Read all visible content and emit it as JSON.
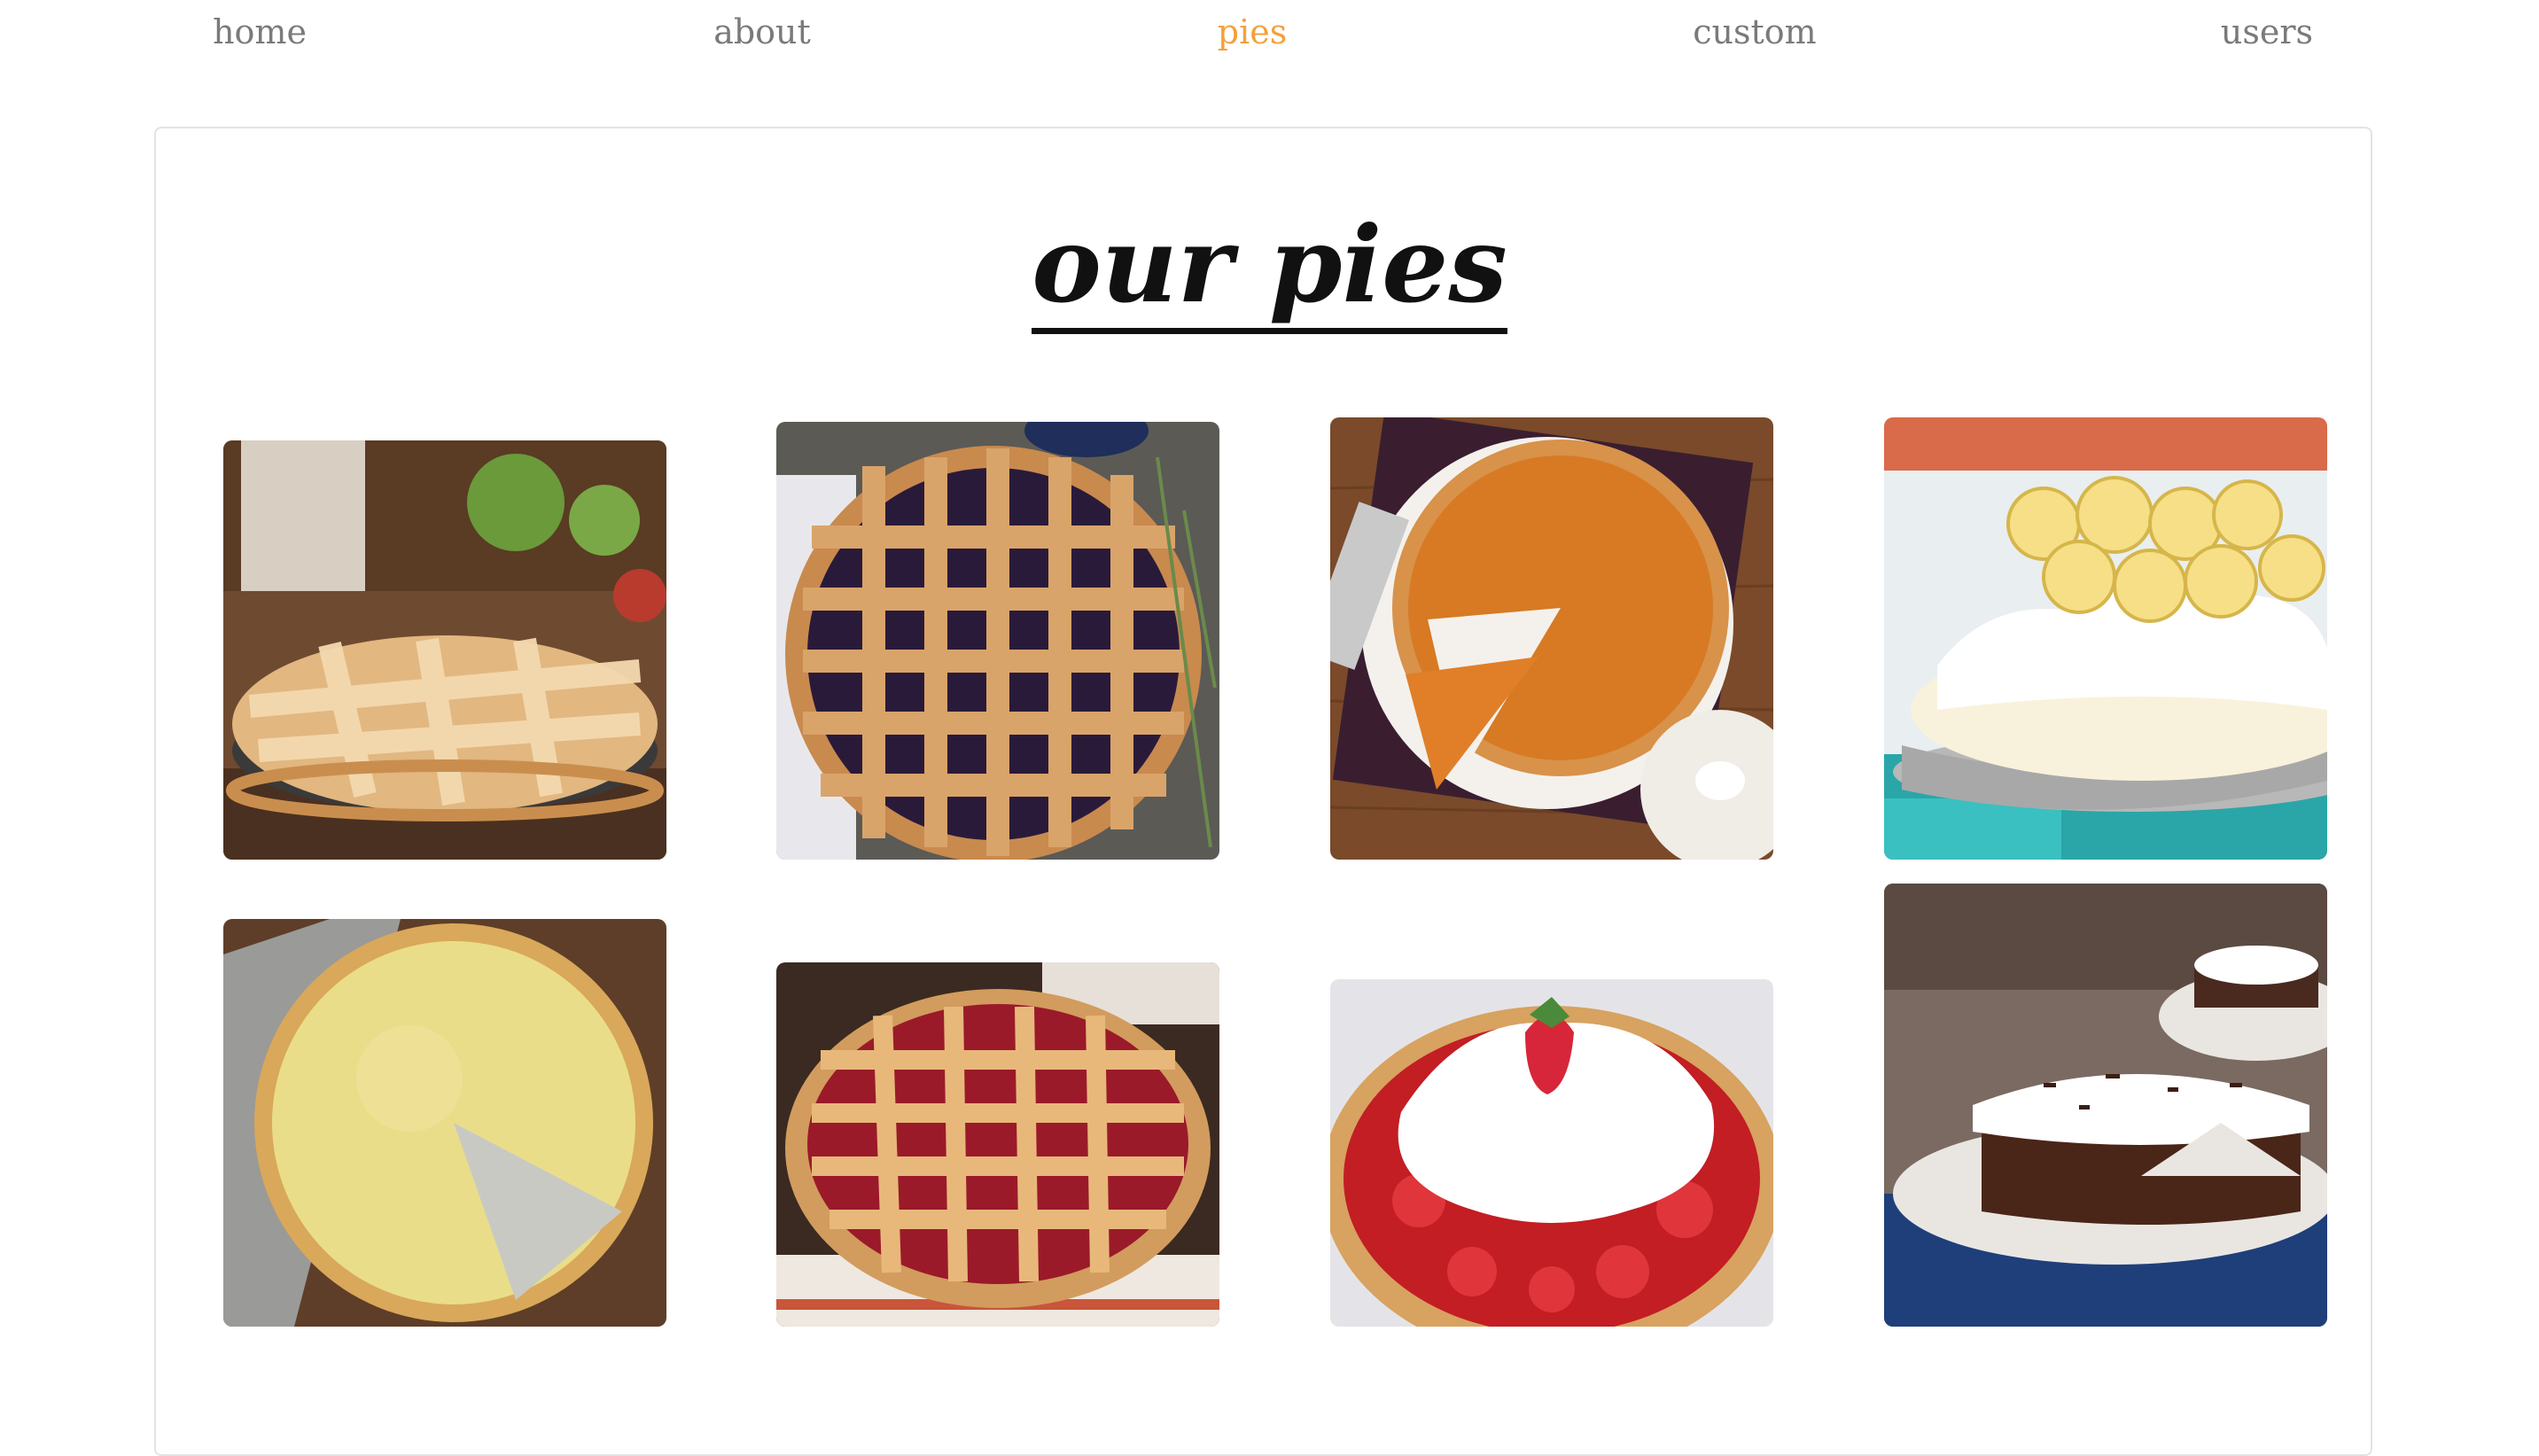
{
  "nav": {
    "items": [
      {
        "label": "home"
      },
      {
        "label": "about"
      },
      {
        "label": "pies"
      },
      {
        "label": "custom"
      },
      {
        "label": "users"
      }
    ],
    "active_color": "#f5a03c",
    "text_color": "#7a7a7a"
  },
  "main": {
    "title": "our pies"
  },
  "pies": [
    {
      "kind": "apple-lattice-pie"
    },
    {
      "kind": "blueberry-lattice-pie"
    },
    {
      "kind": "pumpkin-pie"
    },
    {
      "kind": "banana-cream-pie"
    },
    {
      "kind": "custard-pie"
    },
    {
      "kind": "cherry-lattice-pie"
    },
    {
      "kind": "strawberry-cream-pie"
    },
    {
      "kind": "chocolate-cream-pie"
    }
  ]
}
